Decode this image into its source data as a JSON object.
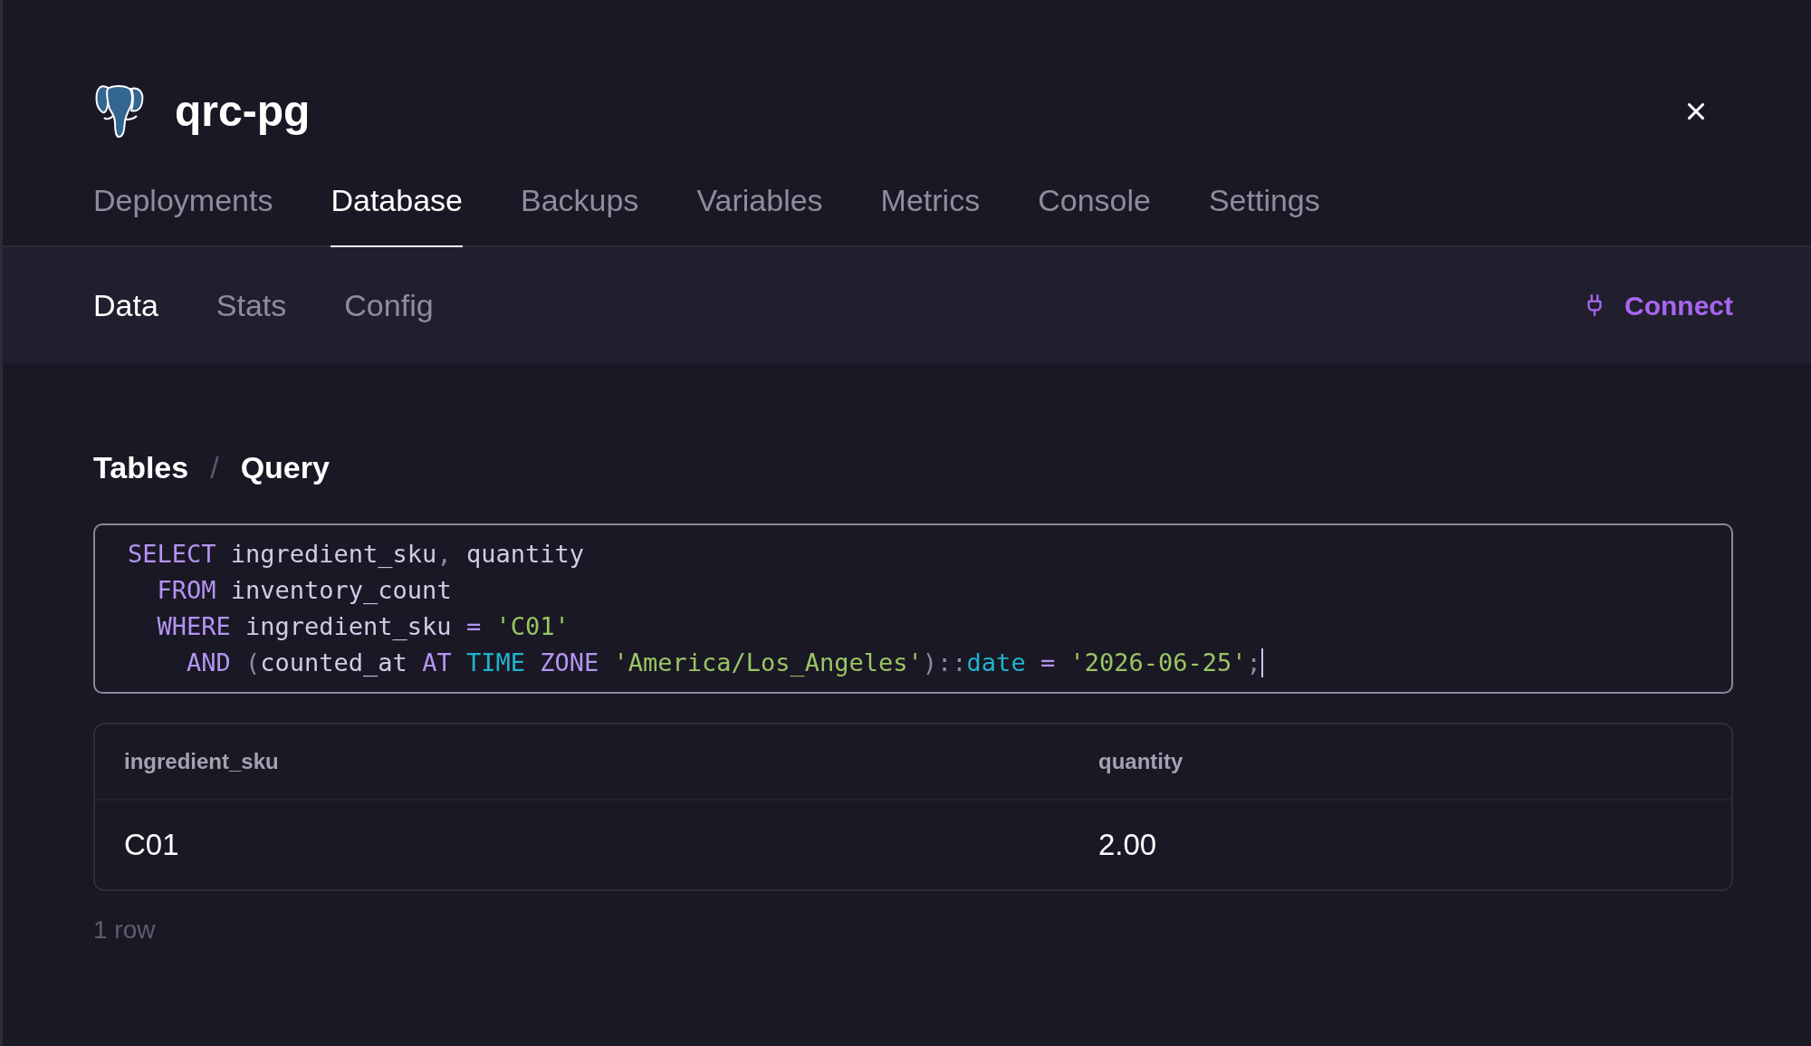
{
  "header": {
    "title": "qrc-pg"
  },
  "tabs": [
    {
      "label": "Deployments",
      "selected": false
    },
    {
      "label": "Database",
      "selected": true
    },
    {
      "label": "Backups",
      "selected": false
    },
    {
      "label": "Variables",
      "selected": false
    },
    {
      "label": "Metrics",
      "selected": false
    },
    {
      "label": "Console",
      "selected": false
    },
    {
      "label": "Settings",
      "selected": false
    }
  ],
  "subtabs": [
    {
      "label": "Data",
      "selected": true
    },
    {
      "label": "Stats",
      "selected": false
    },
    {
      "label": "Config",
      "selected": false
    }
  ],
  "connect_button": {
    "label": "Connect"
  },
  "breadcrumb": [
    {
      "label": "Tables"
    },
    {
      "label": "/"
    },
    {
      "label": "Query"
    }
  ],
  "editor": {
    "focused": true,
    "lines": [
      [
        {
          "text": "SELECT",
          "kind": "keyword"
        },
        {
          "text": " ingredient_sku",
          "kind": "plain"
        },
        {
          "text": ",",
          "kind": "punct"
        },
        {
          "text": " quantity",
          "kind": "plain"
        }
      ],
      [
        {
          "text": "  FROM",
          "kind": "keyword"
        },
        {
          "text": " inventory_count",
          "kind": "plain"
        }
      ],
      [
        {
          "text": "  WHERE",
          "kind": "keyword"
        },
        {
          "text": " ingredient_sku ",
          "kind": "plain"
        },
        {
          "text": "=",
          "kind": "keyword"
        },
        {
          "text": " 'C01'",
          "kind": "string"
        }
      ],
      [
        {
          "text": "    AND",
          "kind": "keyword"
        },
        {
          "text": " (",
          "kind": "punct"
        },
        {
          "text": "counted_at ",
          "kind": "plain"
        },
        {
          "text": "AT",
          "kind": "keyword"
        },
        {
          "text": " TIME",
          "kind": "type"
        },
        {
          "text": " ZONE",
          "kind": "keyword"
        },
        {
          "text": " 'America/Los_Angeles'",
          "kind": "string"
        },
        {
          "text": ")::",
          "kind": "punct"
        },
        {
          "text": "date",
          "kind": "type"
        },
        {
          "text": " = ",
          "kind": "keyword"
        },
        {
          "text": "'2026-06-25'",
          "kind": "string"
        },
        {
          "text": ";",
          "kind": "punct"
        }
      ]
    ]
  },
  "table": {
    "columns": [
      "ingredient_sku",
      "quantity"
    ],
    "rows": [
      [
        "C01",
        "2.00"
      ]
    ]
  },
  "row_count": "1 row"
}
